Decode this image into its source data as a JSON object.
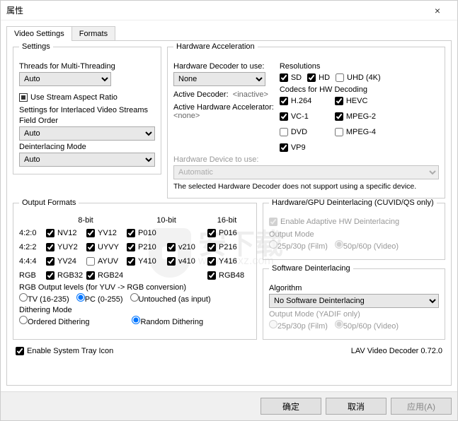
{
  "window": {
    "title": "属性"
  },
  "tabs": {
    "video_settings": "Video Settings",
    "formats": "Formats"
  },
  "settings": {
    "title": "Settings",
    "threads_label": "Threads for Multi-Threading",
    "threads_value": "Auto",
    "use_stream_aspect": "Use Stream Aspect Ratio",
    "interlaced_label": "Settings for Interlaced Video Streams",
    "field_order_label": "Field Order",
    "field_order_value": "Auto",
    "deint_mode_label": "Deinterlacing Mode",
    "deint_mode_value": "Auto"
  },
  "hw": {
    "title": "Hardware Acceleration",
    "decoder_label": "Hardware Decoder to use:",
    "decoder_value": "None",
    "active_decoder_label": "Active Decoder:",
    "active_decoder_value": "<inactive>",
    "active_accel_label": "Active Hardware Accelerator:",
    "active_accel_value": "<none>",
    "device_label": "Hardware Device to use:",
    "device_value": "Automatic",
    "device_note": "The selected Hardware Decoder does not support using a specific device.",
    "res_label": "Resolutions",
    "res": {
      "sd": "SD",
      "hd": "HD",
      "uhd": "UHD (4K)"
    },
    "codecs_label": "Codecs for HW Decoding",
    "codecs": {
      "h264": "H.264",
      "hevc": "HEVC",
      "vc1": "VC-1",
      "mpeg2": "MPEG-2",
      "dvd": "DVD",
      "mpeg4": "MPEG-4",
      "vp9": "VP9"
    }
  },
  "output": {
    "title": "Output Formats",
    "bits": {
      "b8": "8-bit",
      "b10": "10-bit",
      "b16": "16-bit"
    },
    "rows": {
      "420": "4:2:0",
      "422": "4:2:2",
      "444": "4:4:4",
      "rgb": "RGB"
    },
    "fmts": {
      "nv12": "NV12",
      "yv12": "YV12",
      "p010": "P010",
      "p016": "P016",
      "yuy2": "YUY2",
      "uyvy": "UYVY",
      "p210": "P210",
      "v210": "v210",
      "p216": "P216",
      "yv24": "YV24",
      "ayuv": "AYUV",
      "y410": "Y410",
      "v410": "v410",
      "y416": "Y416",
      "rgb32": "RGB32",
      "rgb24": "RGB24",
      "rgb48": "RGB48"
    },
    "rgb_levels_label": "RGB Output levels (for YUV -> RGB conversion)",
    "rgb_levels": {
      "tv": "TV (16-235)",
      "pc": "PC (0-255)",
      "untouched": "Untouched (as input)"
    },
    "dithering_label": "Dithering Mode",
    "dithering": {
      "ordered": "Ordered Dithering",
      "random": "Random Dithering"
    }
  },
  "gpu_deint": {
    "title": "Hardware/GPU Deinterlacing (CUVID/QS only)",
    "enable": "Enable Adaptive HW Deinterlacing",
    "output_mode_label": "Output Mode",
    "film": "25p/30p (Film)",
    "video": "50p/60p (Video)"
  },
  "sw_deint": {
    "title": "Software Deinterlacing",
    "algo_label": "Algorithm",
    "algo_value": "No Software Deinterlacing",
    "output_mode_label": "Output Mode (YADIF only)",
    "film": "25p/30p (Film)",
    "video": "50p/60p (Video)"
  },
  "footer": {
    "tray": "Enable System Tray Icon",
    "version": "LAV Video Decoder 0.72.0"
  },
  "buttons": {
    "ok": "确定",
    "cancel": "取消",
    "apply": "应用(A)"
  },
  "watermark": {
    "text1": "安下载",
    "text2": "www.anxz.com"
  }
}
